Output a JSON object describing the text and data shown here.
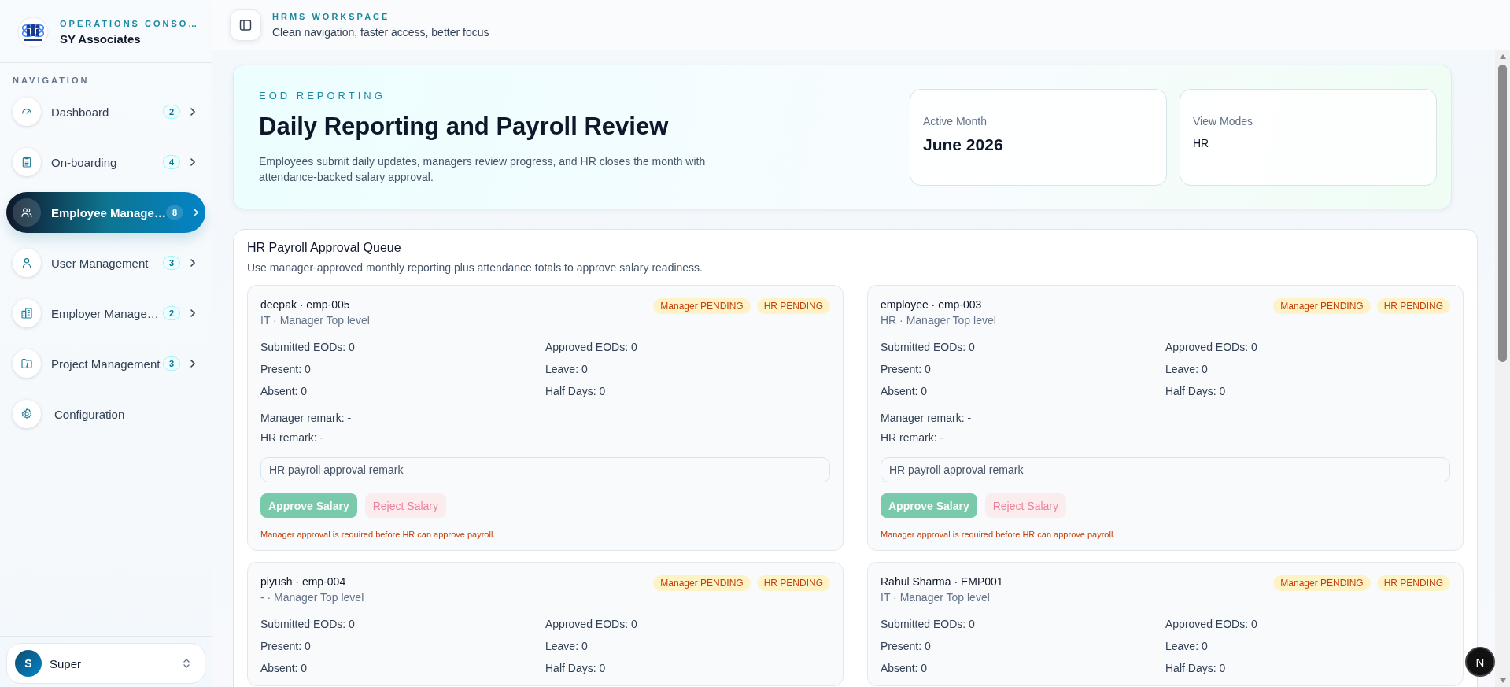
{
  "sidebar": {
    "brand": {
      "eyebrow": "OPERATIONS CONSO…",
      "name": "SY Associates"
    },
    "section_label": "NAVIGATION",
    "items": [
      {
        "label": "Dashboard",
        "count": "2",
        "selected": false,
        "kind": "gauge"
      },
      {
        "label": "On-boarding",
        "count": "4",
        "selected": false,
        "kind": "clipboard"
      },
      {
        "label": "Employee Manage…",
        "count": "8",
        "selected": true,
        "kind": "users"
      },
      {
        "label": "User Management",
        "count": "3",
        "selected": false,
        "kind": "user"
      },
      {
        "label": "Employer Manage…",
        "count": "2",
        "selected": false,
        "kind": "building"
      },
      {
        "label": "Project Management",
        "count": "3",
        "selected": false,
        "kind": "folder"
      },
      {
        "label": "Configuration",
        "selected": false,
        "kind": "gear"
      }
    ],
    "user": {
      "initial": "S",
      "name": "Super"
    }
  },
  "header": {
    "eyebrow": "HRMS WORKSPACE",
    "subtitle": "Clean navigation, faster access, better focus"
  },
  "hero": {
    "eyebrow": "EOD REPORTING",
    "title": "Daily Reporting and Payroll Review",
    "description": "Employees submit daily updates, managers review progress, and HR closes the month with attendance-backed salary approval.",
    "stats": [
      {
        "label": "Active Month",
        "value": "June 2026",
        "kind": "large"
      },
      {
        "label": "View Modes",
        "value": "HR",
        "kind": "small"
      }
    ]
  },
  "queue": {
    "title": "HR Payroll Approval Queue",
    "subtitle": "Use manager-approved monthly reporting plus attendance totals to approve salary readiness.",
    "cards": [
      {
        "name": "deepak · emp-005",
        "meta": "IT · Manager Top level",
        "badges": [
          "Manager PENDING",
          "HR PENDING"
        ],
        "stats": [
          "Submitted EODs: 0",
          "Approved EODs: 0",
          "Present: 0",
          "Leave: 0",
          "Absent: 0",
          "Half Days: 0"
        ],
        "remarks": [
          "Manager remark: -",
          "HR remark: -"
        ],
        "remark_placeholder": "HR payroll approval remark",
        "buttons": [
          {
            "label": "Approve Salary",
            "kind": "approve",
            "disabled": true
          },
          {
            "label": "Reject Salary",
            "kind": "reject",
            "disabled": true
          }
        ],
        "note": "Manager approval is required before HR can approve payroll."
      },
      {
        "name": "employee · emp-003",
        "meta": "HR · Manager Top level",
        "badges": [
          "Manager PENDING",
          "HR PENDING"
        ],
        "stats": [
          "Submitted EODs: 0",
          "Approved EODs: 0",
          "Present: 0",
          "Leave: 0",
          "Absent: 0",
          "Half Days: 0"
        ],
        "remarks": [
          "Manager remark: -",
          "HR remark: -"
        ],
        "remark_placeholder": "HR payroll approval remark",
        "buttons": [
          {
            "label": "Approve Salary",
            "kind": "approve",
            "disabled": true
          },
          {
            "label": "Reject Salary",
            "kind": "reject",
            "disabled": true
          }
        ],
        "note": "Manager approval is required before HR can approve payroll."
      },
      {
        "name": "piyush · emp-004",
        "meta": "- · Manager Top level",
        "badges": [
          "Manager PENDING",
          "HR PENDING"
        ],
        "stats": [
          "Submitted EODs: 0",
          "Approved EODs: 0",
          "Present: 0",
          "Leave: 0",
          "Absent: 0",
          "Half Days: 0"
        ]
      },
      {
        "name": "Rahul Sharma · EMP001",
        "meta": "IT · Manager Top level",
        "badges": [
          "Manager PENDING",
          "HR PENDING"
        ],
        "stats": [
          "Submitted EODs: 0",
          "Approved EODs: 0",
          "Present: 0",
          "Leave: 0",
          "Absent: 0",
          "Half Days: 0"
        ]
      }
    ]
  },
  "dev_badge": "N"
}
